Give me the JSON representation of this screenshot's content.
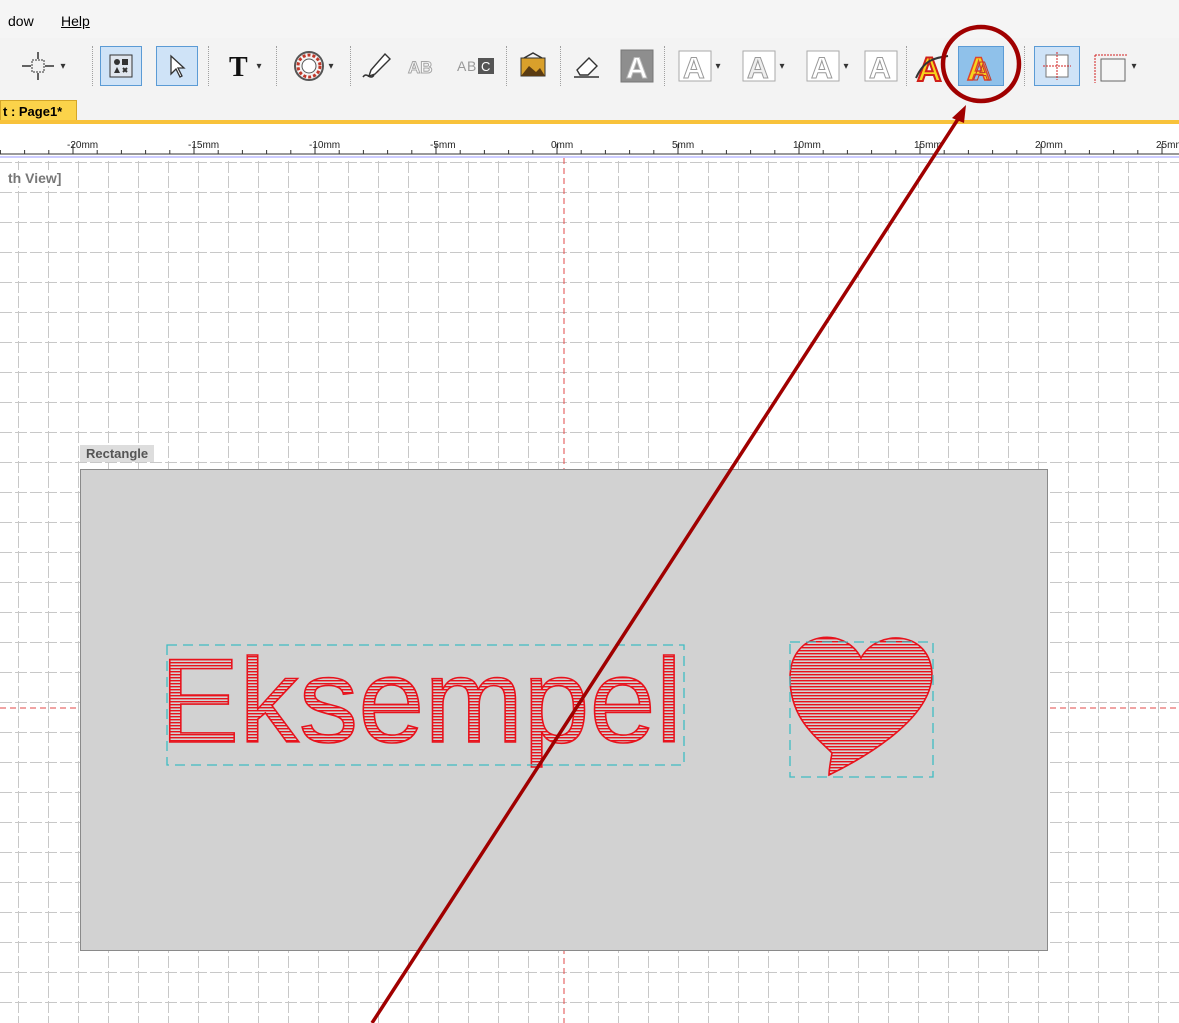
{
  "menu": {
    "items": [
      "dow",
      "Help"
    ]
  },
  "toolbar": {
    "buttons": [
      "move-tool",
      "symbol-tool",
      "select-tool",
      "text-tool",
      "frame-tool",
      "signature-tool",
      "arch-text-tool",
      "frame-text-tool",
      "image-tool",
      "eraser-tool",
      "outline-a",
      "outline-a-2",
      "outline-a-3",
      "outline-a-4",
      "outline-a-5",
      "colored-a",
      "raster-a-highlighted",
      "grid-tool",
      "rect-tool"
    ]
  },
  "tab": {
    "label": "t : Page1*"
  },
  "ruler": {
    "labels": [
      "-20mm",
      "-15mm",
      "-10mm",
      "-5mm",
      "0mm",
      "5mm",
      "10mm",
      "15mm",
      "20mm",
      "25mm"
    ]
  },
  "canvas": {
    "view_label": "th View]",
    "rectangle_label": "Rectangle",
    "text": "Eksempel",
    "shape": "heart",
    "text_color": "#e8121c",
    "annotation_color": "#a00000",
    "background": "#d2d2d2"
  }
}
